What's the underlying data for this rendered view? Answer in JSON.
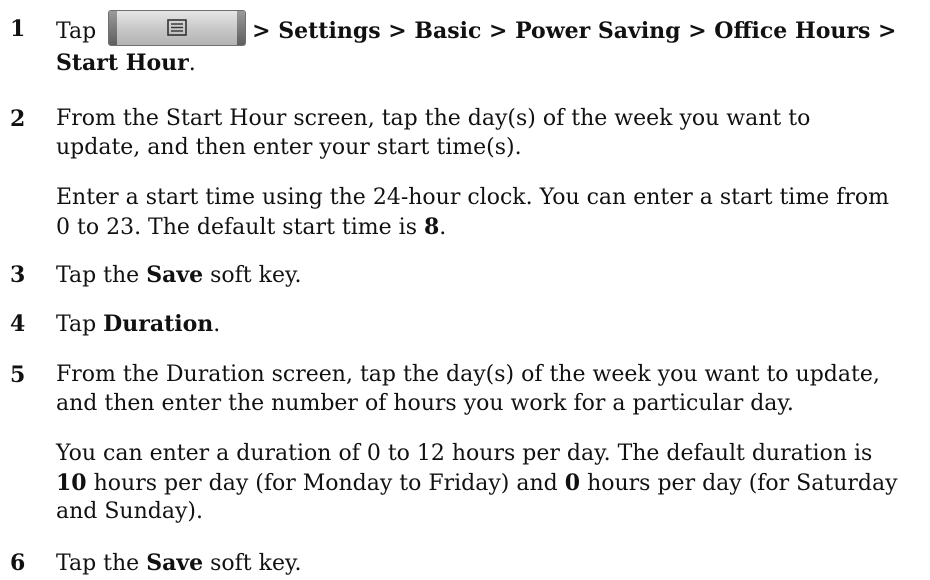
{
  "steps": [
    {
      "number": "1",
      "tap": "Tap",
      "path": "> Settings > Basic > Power Saving > Office Hours >",
      "path_end": "Start Hour",
      "path_end_suffix": "."
    },
    {
      "number": "2",
      "line1": "From the Start Hour screen, tap the day(s) of the week you want to",
      "line2": "update, and then enter your start time(s).",
      "note_line1": "Enter a start time using the 24-hour clock. You can enter a start time from",
      "note_line2_prefix": "0 to 23. The default start time is",
      "note_line2_bold": "8",
      "note_line2_suffix": "."
    },
    {
      "number": "3",
      "prefix": "Tap the",
      "bold": "Save",
      "suffix": "soft key."
    },
    {
      "number": "4",
      "prefix": "Tap",
      "bold": "Duration",
      "suffix": "."
    },
    {
      "number": "5",
      "line1": "From the Duration screen, tap the day(s) of the week you want to update,",
      "line2": "and then enter the number of hours you work for a particular day.",
      "note_line1": "You can enter a duration of 0 to 12 hours per day. The default duration is",
      "note_line2_bold_a": "10",
      "note_line2_mid": "hours per day (for Monday to Friday) and",
      "note_line2_bold_b": "0",
      "note_line2_end": "hours per day (for Saturday",
      "note_line3": "and Sunday)."
    },
    {
      "number": "6",
      "prefix": "Tap the",
      "bold": "Save",
      "suffix": "soft key."
    }
  ],
  "icons": {
    "home_button_icon": "menu-list-icon"
  }
}
